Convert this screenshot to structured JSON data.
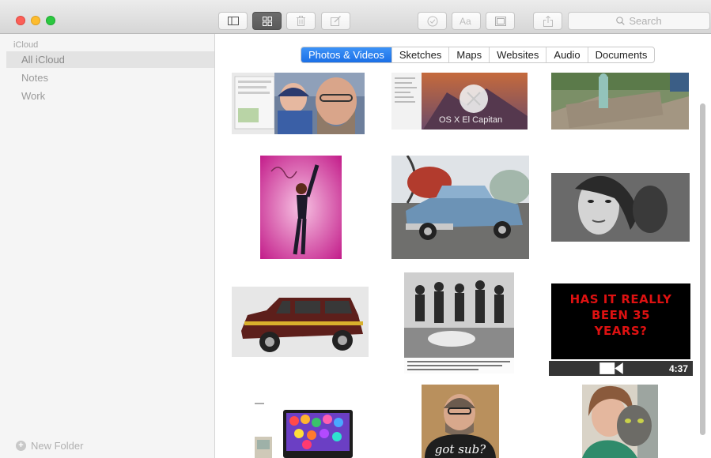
{
  "toolbar": {
    "search_placeholder": "Search"
  },
  "sidebar": {
    "header": "iCloud",
    "items": [
      {
        "label": "All iCloud",
        "selected": true
      },
      {
        "label": "Notes",
        "selected": false
      },
      {
        "label": "Work",
        "selected": false
      }
    ],
    "new_folder_label": "New Folder"
  },
  "filter_tabs": [
    {
      "label": "Photos & Videos",
      "active": true
    },
    {
      "label": "Sketches",
      "active": false
    },
    {
      "label": "Maps",
      "active": false
    },
    {
      "label": "Websites",
      "active": false
    },
    {
      "label": "Audio",
      "active": false
    },
    {
      "label": "Documents",
      "active": false
    }
  ],
  "attachments": {
    "osx_caption": "OS X El Capitan",
    "video_title": "HAS IT REALLY BEEN 35 YEARS?",
    "video_duration": "4:37",
    "tshirt_text": "got sub?"
  },
  "colors": {
    "accent": "#1b6fe6",
    "sidebar_bg": "#f5f5f5",
    "toolbar_bg": "#d6d6d6"
  }
}
